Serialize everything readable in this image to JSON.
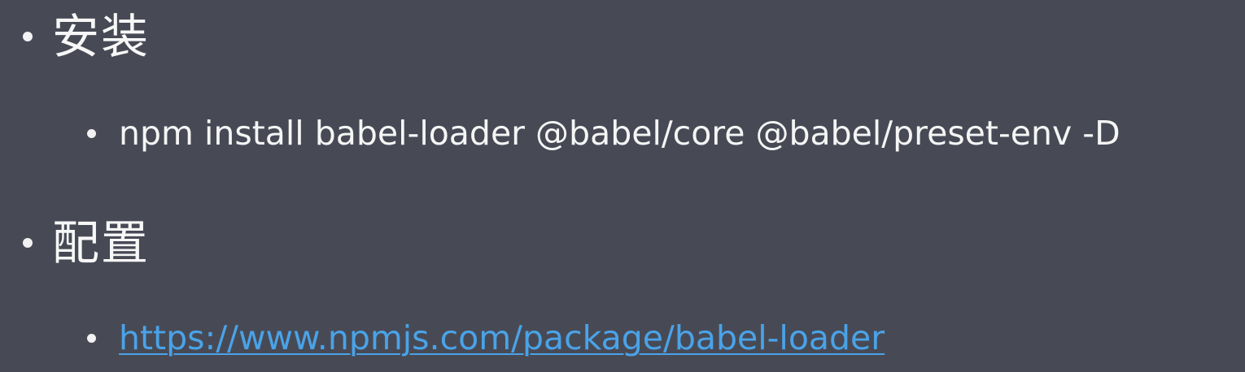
{
  "slide": {
    "items": [
      {
        "label": "安装",
        "children": [
          {
            "text": "npm install babel-loader @babel/core @babel/preset-env -D"
          }
        ]
      },
      {
        "label": "配置",
        "children": [
          {
            "link": "https://www.npmjs.com/package/babel-loader"
          }
        ]
      }
    ]
  },
  "colors": {
    "background": "#474a55",
    "text": "#f7f7f7",
    "link": "#4aa3e8"
  }
}
